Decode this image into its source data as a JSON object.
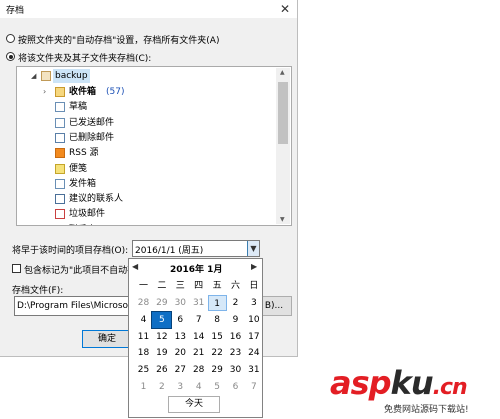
{
  "window": {
    "title": "存档",
    "close_glyph": "✕"
  },
  "options": {
    "radio1": "按照文件夹的\"自动存档\"设置，存档所有文件夹(A)",
    "radio2": "将该文件夹及其子文件夹存档(C):",
    "selected": "radio2"
  },
  "tree": {
    "root": "backup",
    "items": [
      {
        "label": "收件箱",
        "badge": "(57)",
        "bold": true,
        "expandable": true,
        "icon": "inbox-icon"
      },
      {
        "label": "草稿",
        "expandable": false,
        "icon": "draft-icon"
      },
      {
        "label": "已发送邮件",
        "expandable": false,
        "icon": "sent-icon"
      },
      {
        "label": "已删除邮件",
        "expandable": false,
        "icon": "trash-icon"
      },
      {
        "label": "RSS 源",
        "expandable": false,
        "icon": "rss-icon"
      },
      {
        "label": "便笺",
        "expandable": false,
        "icon": "note-icon"
      },
      {
        "label": "发件箱",
        "expandable": false,
        "icon": "outbox-icon"
      },
      {
        "label": "建议的联系人",
        "expandable": false,
        "icon": "contact-icon"
      },
      {
        "label": "垃圾邮件",
        "expandable": false,
        "icon": "junk-icon"
      },
      {
        "label": "联系人",
        "expandable": true,
        "icon": "contact-icon"
      }
    ]
  },
  "archive_before": {
    "label": "将早于该时间的项目存档(O):",
    "value": "2016/1/1 (周五)"
  },
  "include_label": "包含标记为\"此项目不自动存",
  "archive_file": {
    "label": "存档文件(F):",
    "value": "D:\\Program Files\\Microsoft",
    "browse": "B)..."
  },
  "ok_label": "确定",
  "calendar": {
    "month": "2016年 1月",
    "prev": "◀",
    "next": "▶",
    "weekdays": [
      "一",
      "二",
      "三",
      "四",
      "五",
      "六",
      "日"
    ],
    "weeks": [
      [
        "28",
        "29",
        "30",
        "31",
        "1",
        "2",
        "3"
      ],
      [
        "4",
        "5",
        "6",
        "7",
        "8",
        "9",
        "10"
      ],
      [
        "11",
        "12",
        "13",
        "14",
        "15",
        "16",
        "17"
      ],
      [
        "18",
        "19",
        "20",
        "21",
        "22",
        "23",
        "24"
      ],
      [
        "25",
        "26",
        "27",
        "28",
        "29",
        "30",
        "31"
      ],
      [
        "1",
        "2",
        "3",
        "4",
        "5",
        "6",
        "7"
      ]
    ],
    "today_label": "今天"
  },
  "watermark": {
    "asp": "asp",
    "ku": "ku",
    "cn": ".cn",
    "sub": "免费网站源码下载站!"
  }
}
